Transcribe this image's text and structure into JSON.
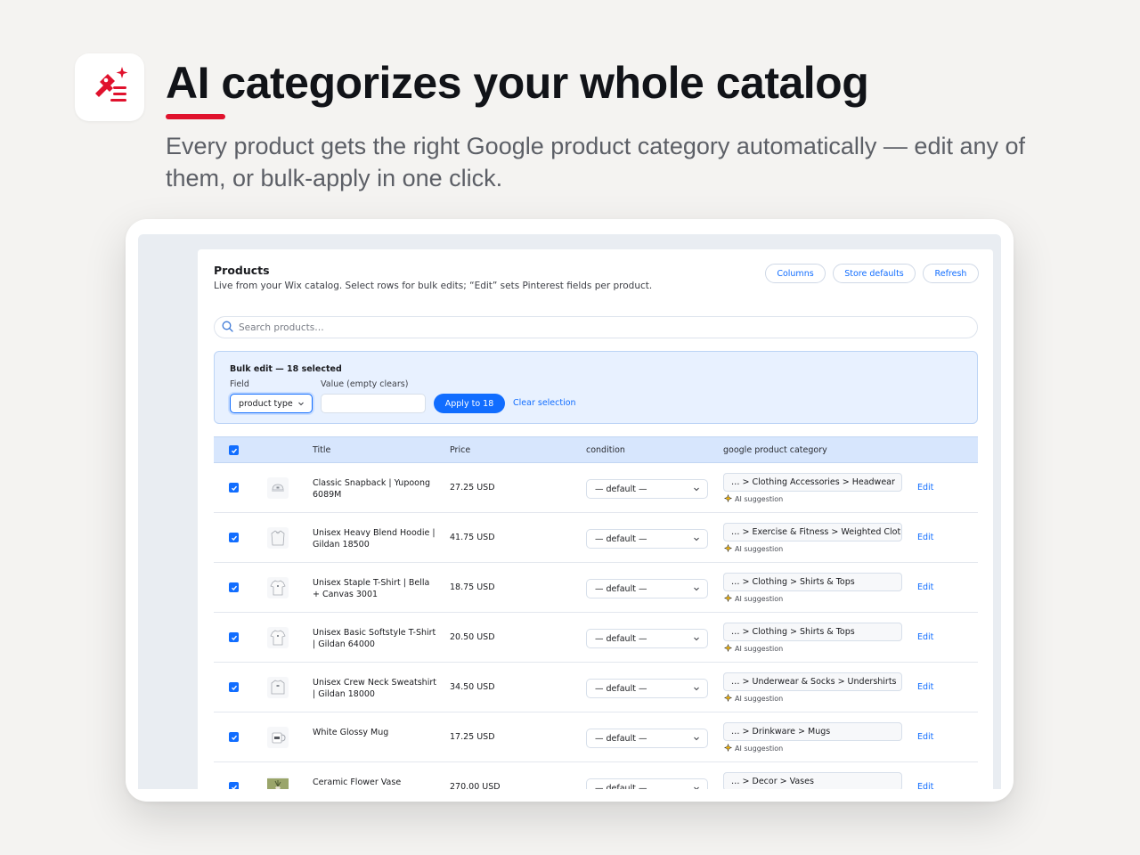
{
  "hero": {
    "headline": "AI categorizes your whole catalog",
    "subhead": "Every product gets the right Google product category automatically — edit any of them, or bulk-apply in one click.",
    "icon": "ai-tag-list-icon",
    "accent_color": "#e0122d"
  },
  "panel": {
    "title": "Products",
    "subtitle": "Live from your Wix catalog. Select rows for bulk edits; “Edit” sets Pinterest fields per product.",
    "buttons": {
      "columns": "Columns",
      "store_defaults": "Store defaults",
      "refresh": "Refresh"
    },
    "search_placeholder": "Search products…",
    "primary_color": "#116dff"
  },
  "bulk": {
    "title": "Bulk edit — 18 selected",
    "field_label": "Field",
    "value_label": "Value (empty clears)",
    "field_value": "product type",
    "value_input": "",
    "apply_label": "Apply to 18",
    "clear_label": "Clear selection"
  },
  "table": {
    "headers": {
      "title": "Title",
      "price": "Price",
      "condition": "condition",
      "category": "google product category"
    },
    "ai_label": "AI suggestion",
    "edit_label": "Edit",
    "rows": [
      {
        "title": "Classic Snapback | Yupoong 6089M",
        "price": "27.25 USD",
        "condition": "— default —",
        "category": "… > Clothing Accessories > Headwear",
        "thumb": "cap-icon",
        "checked": true,
        "ai": true
      },
      {
        "title": "Unisex Heavy Blend Hoodie | Gildan 18500",
        "price": "41.75 USD",
        "condition": "— default —",
        "category": "… > Exercise & Fitness > Weighted Clothing",
        "thumb": "hoodie-icon",
        "checked": true,
        "ai": true
      },
      {
        "title": "Unisex Staple T-Shirt | Bella + Canvas 3001",
        "price": "18.75 USD",
        "condition": "— default —",
        "category": "… > Clothing > Shirts & Tops",
        "thumb": "tshirt-icon",
        "checked": true,
        "ai": true
      },
      {
        "title": "Unisex Basic Softstyle T-Shirt | Gildan 64000",
        "price": "20.50 USD",
        "condition": "— default —",
        "category": "… > Clothing > Shirts & Tops",
        "thumb": "tshirt-icon",
        "checked": true,
        "ai": true
      },
      {
        "title": "Unisex Crew Neck Sweatshirt | Gildan 18000",
        "price": "34.50 USD",
        "condition": "— default —",
        "category": "… > Underwear & Socks > Undershirts",
        "thumb": "sweatshirt-icon",
        "checked": true,
        "ai": true
      },
      {
        "title": "White Glossy Mug",
        "price": "17.25 USD",
        "condition": "— default —",
        "category": "… > Drinkware > Mugs",
        "thumb": "mug-icon",
        "checked": true,
        "ai": true
      },
      {
        "title": "Ceramic Flower Vase",
        "price": "270.00 USD",
        "condition": "— default —",
        "category": "… > Decor > Vases",
        "thumb": "vase-photo",
        "checked": true,
        "ai": true
      }
    ]
  }
}
